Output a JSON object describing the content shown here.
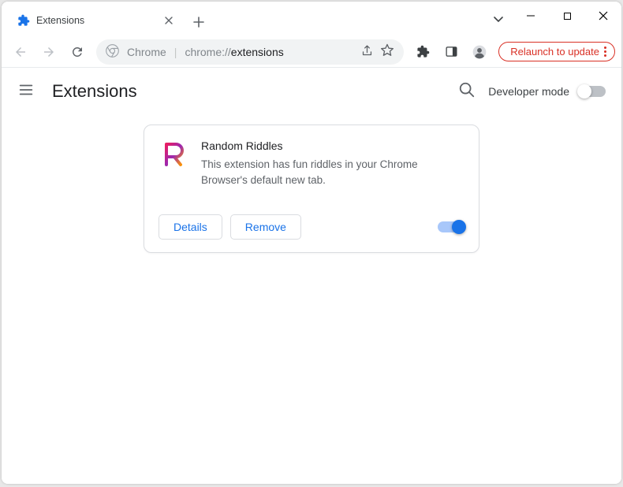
{
  "window": {
    "tab_title": "Extensions",
    "tab_chevron": true
  },
  "toolbar": {
    "url_label": "Chrome",
    "url_path_prefix": "chrome://",
    "url_path_bold": "extensions",
    "relaunch_label": "Relaunch to update"
  },
  "page": {
    "title": "Extensions",
    "developer_mode_label": "Developer mode",
    "developer_mode_on": false
  },
  "extension": {
    "name": "Random Riddles",
    "description": "This extension has fun riddles in your Chrome Browser's default new tab.",
    "details_label": "Details",
    "remove_label": "Remove",
    "enabled": true,
    "icon": "R-gradient"
  }
}
